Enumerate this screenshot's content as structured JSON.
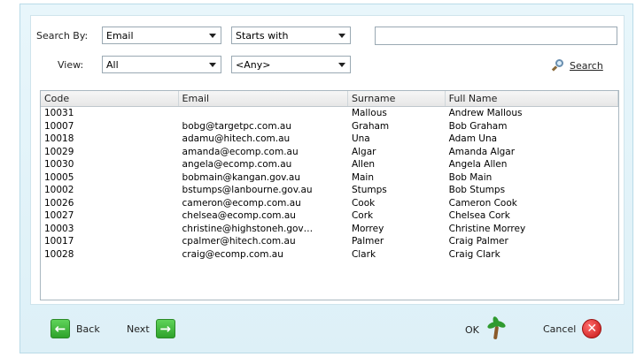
{
  "filters": {
    "search_by_label": "Search By:",
    "search_by_value": "Email",
    "match_value": "Starts with",
    "search_text": "",
    "view_label": "View:",
    "view_value": "All",
    "any_value": "<Any>",
    "search_button": "Search"
  },
  "table": {
    "columns": [
      "Code",
      "Email",
      "Surname",
      "Full Name"
    ],
    "rows": [
      [
        "10031",
        "",
        "Mallous",
        "Andrew Mallous"
      ],
      [
        "10007",
        "bobg@targetpc.com.au",
        "Graham",
        "Bob Graham"
      ],
      [
        "10018",
        "adamu@hitech.com.au",
        "Una",
        "Adam Una"
      ],
      [
        "10029",
        "amanda@ecomp.com.au",
        "Algar",
        "Amanda Algar"
      ],
      [
        "10030",
        "angela@ecomp.com.au",
        "Allen",
        "Angela Allen"
      ],
      [
        "10005",
        "bobmain@kangan.gov.au",
        "Main",
        "Bob Main"
      ],
      [
        "10002",
        "bstumps@lanbourne.gov.au",
        "Stumps",
        "Bob Stumps"
      ],
      [
        "10026",
        "cameron@ecomp.com.au",
        "Cook",
        "Cameron Cook"
      ],
      [
        "10027",
        "chelsea@ecomp.com.au",
        "Cork",
        "Chelsea Cork"
      ],
      [
        "10003",
        "christine@highstoneh.gov…",
        "Morrey",
        "Christine Morrey"
      ],
      [
        "10017",
        "cpalmer@hitech.com.au",
        "Palmer",
        "Craig Palmer"
      ],
      [
        "10028",
        "craig@ecomp.com.au",
        "Clark",
        "Craig Clark"
      ]
    ]
  },
  "footer": {
    "back_label": "Back",
    "next_label": "Next",
    "ok_label": "OK",
    "cancel_label": "Cancel"
  },
  "icons": {
    "back": "arrow-left-icon",
    "next": "arrow-right-icon",
    "ok": "palm-tree-icon",
    "cancel": "cancel-x-icon",
    "search": "magnifier-icon"
  },
  "colors": {
    "frame_background": "#e3f4fa",
    "arrow_green": "#2ea22a",
    "cancel_red": "#c41414"
  }
}
